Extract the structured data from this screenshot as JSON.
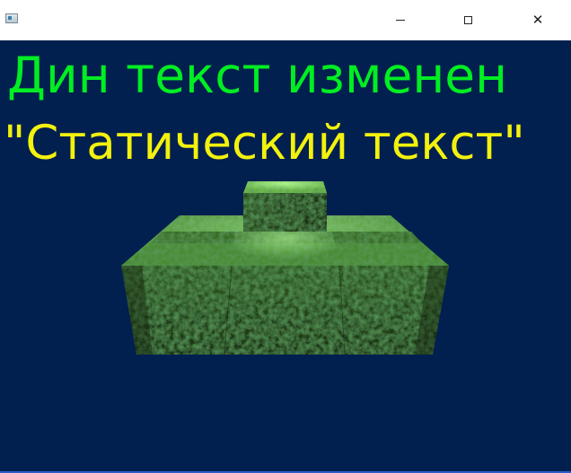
{
  "window": {
    "controls": {
      "minimize_icon": "minimize-icon",
      "maximize_icon": "maximize-icon",
      "close_icon": "close-icon",
      "close_glyph": "✕"
    }
  },
  "viewport": {
    "background_color": "#01204f",
    "dynamic_text": "Дин текст изменен",
    "dynamic_text_color": "#00ee22",
    "static_text": "\"Статический текст\"",
    "static_text_color": "#f3f10e"
  }
}
